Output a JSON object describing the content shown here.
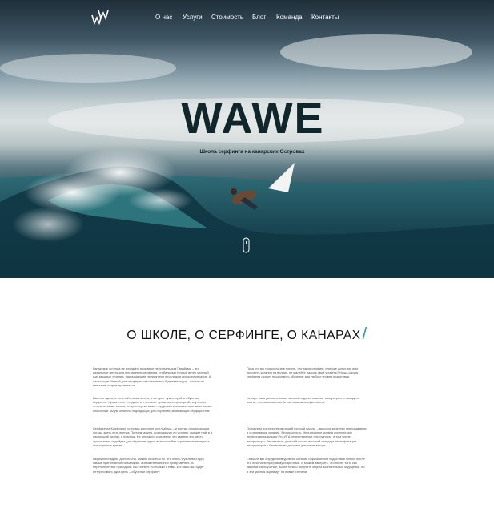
{
  "nav": {
    "items": [
      "О нас",
      "Услуги",
      "Стоимость",
      "Блог",
      "Команда",
      "Контакты"
    ]
  },
  "hero": {
    "title": "WAWE",
    "subtitle": "Школа серфинга на канарских Островах"
  },
  "about": {
    "title": "О ШКОЛЕ, О СЕРФИНГЕ, О КАНАРАХ",
    "slash": "/",
    "left": [
      "Канарские острова не случайно называют персональным Гавайями – это идеальное место для постижения серфинга: стабильный теплый ветер круглый год, мощные течения, накрывающие неприятную прохладу и прозрачное море. А настоящим Меккой для серферистов становится Фуэртевентура – второй по величине остров архипелага.",
      "Именно здесь, in чем в Испании место, в которое нужно пройти обучение серфинга. Кроме того, что денеги и сложно: лучше зона присоргайт изучению отличительные волны, fu артенгкутка может гордиться и множеством живописных способных залув, отлично подходящих для обучения начинающих серферистов.",
      "Серфинг на Канарских островах доступен круглый год – и волны, и подходящая погода здесь есть всегда. Причем можно, подходящую по уровню, сможет найти и настоящий профи, и новичок. Не случайно считается, что именно это место лучше всего подойдет для обучения: здесь возможно без стремления перерыва полноценное время.",
      "Переменно вдоль достаточна. имеем обойти и то, что очень Фуэртевен-турс самые приголовные на Канарах. Житом неповноноо представлять из переполненных пригоднов. Вы станете Но только с теми, кто как и вы, будет интересовать одна цель – обучение серфингу."
    ],
    "right": [
      "Пока что вы только хотите понять, что такое серфинг, или уже испытали всю прелесть катания на волнах, не жалейте ладонь свой уровень? Наша школа серфинга окажет продолжить обучение для любого уровня подготовки.",
      "Четыре часа увлекательных занятий в день позволят вам уверенно овладеть волны, почувствовать себя настоящим серфингистом.",
      "Основным достоинством нашей русской школы – высокое качество преподавания и организации занятий. Безопасность. Несгоночные уровни инструкторы профессиональными Pro-ИТА ответственные инструкторы, в том числе инструкторы, бессвязные, у нашей школы высокий стандарт квалификации инструкторов с беспечными досками для начинающих.",
      "Сначала мы определяем уровень катания и физической подготовки только после что начинаем программу подготовки. И можем заверить, что после того, как закончится обучение, вы не только получите морем волнительных ощущений, но и эти умения поднимут на новые степени."
    ]
  }
}
